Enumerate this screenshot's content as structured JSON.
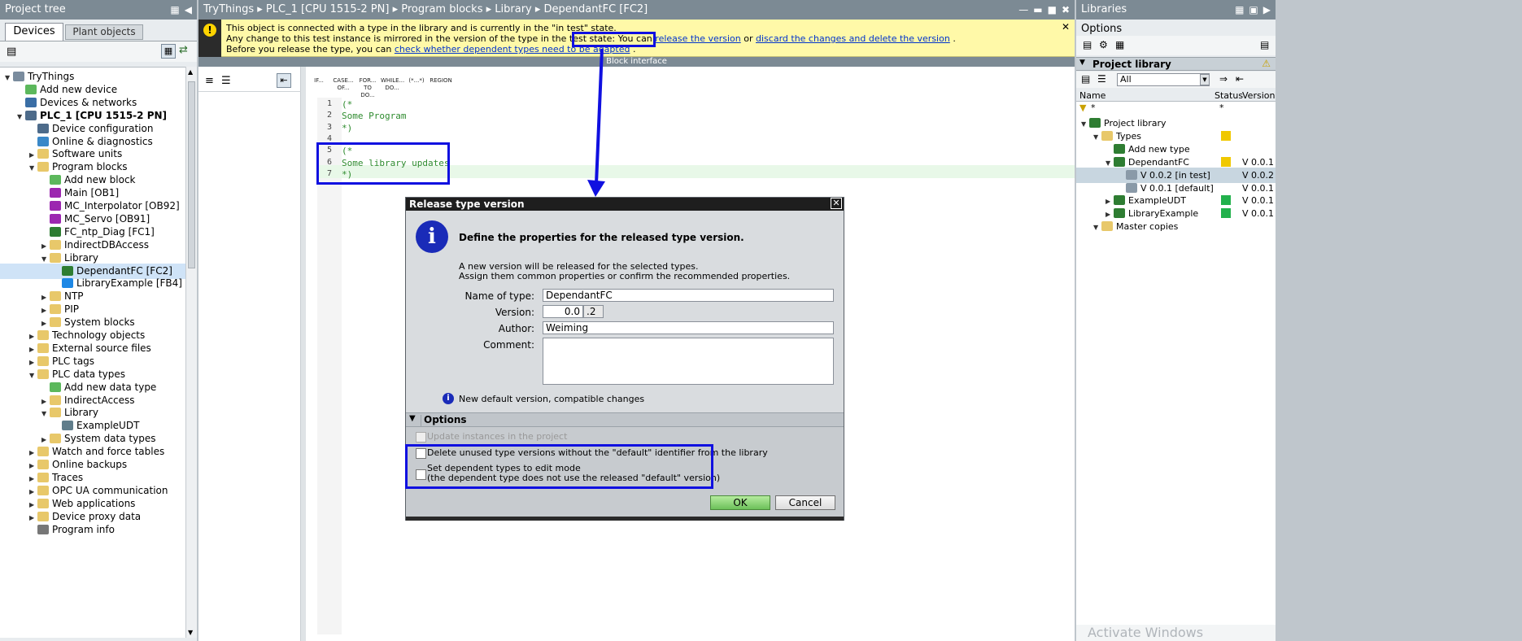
{
  "project_tree": {
    "title": "Project tree",
    "tabs": [
      "Devices",
      "Plant objects"
    ],
    "items": [
      {
        "label": "TryThings",
        "depth": 0,
        "arrow": "▼",
        "icon": "project-icon"
      },
      {
        "label": "Add new device",
        "depth": 1,
        "arrow": "",
        "icon": "add-icon"
      },
      {
        "label": "Devices & networks",
        "depth": 1,
        "arrow": "",
        "icon": "network-icon"
      },
      {
        "label": "PLC_1 [CPU 1515-2 PN]",
        "depth": 1,
        "arrow": "▼",
        "icon": "plc-icon",
        "bold": true
      },
      {
        "label": "Device configuration",
        "depth": 2,
        "arrow": "",
        "icon": "config-icon"
      },
      {
        "label": "Online & diagnostics",
        "depth": 2,
        "arrow": "",
        "icon": "diag-icon"
      },
      {
        "label": "Software units",
        "depth": 2,
        "arrow": "▶",
        "icon": "folder-icon"
      },
      {
        "label": "Program blocks",
        "depth": 2,
        "arrow": "▼",
        "icon": "folder-icon"
      },
      {
        "label": "Add new block",
        "depth": 3,
        "arrow": "",
        "icon": "add-icon"
      },
      {
        "label": "Main [OB1]",
        "depth": 3,
        "arrow": "",
        "icon": "ob-icon"
      },
      {
        "label": "MC_Interpolator [OB92]",
        "depth": 3,
        "arrow": "",
        "icon": "ob-icon"
      },
      {
        "label": "MC_Servo [OB91]",
        "depth": 3,
        "arrow": "",
        "icon": "ob-icon"
      },
      {
        "label": "FC_ntp_Diag [FC1]",
        "depth": 3,
        "arrow": "",
        "icon": "fc-icon"
      },
      {
        "label": "IndirectDBAccess",
        "depth": 3,
        "arrow": "▶",
        "icon": "folder-icon"
      },
      {
        "label": "Library",
        "depth": 3,
        "arrow": "▼",
        "icon": "folder-icon"
      },
      {
        "label": "DependantFC [FC2]",
        "depth": 4,
        "arrow": "",
        "icon": "fc-icon",
        "selected": true
      },
      {
        "label": "LibraryExample [FB4]",
        "depth": 4,
        "arrow": "",
        "icon": "fb-icon"
      },
      {
        "label": "NTP",
        "depth": 3,
        "arrow": "▶",
        "icon": "folder-icon"
      },
      {
        "label": "PIP",
        "depth": 3,
        "arrow": "▶",
        "icon": "folder-icon"
      },
      {
        "label": "System blocks",
        "depth": 3,
        "arrow": "▶",
        "icon": "folder-icon"
      },
      {
        "label": "Technology objects",
        "depth": 2,
        "arrow": "▶",
        "icon": "folder-icon"
      },
      {
        "label": "External source files",
        "depth": 2,
        "arrow": "▶",
        "icon": "folder-icon"
      },
      {
        "label": "PLC tags",
        "depth": 2,
        "arrow": "▶",
        "icon": "folder-icon"
      },
      {
        "label": "PLC data types",
        "depth": 2,
        "arrow": "▼",
        "icon": "folder-icon"
      },
      {
        "label": "Add new data type",
        "depth": 3,
        "arrow": "",
        "icon": "add-icon"
      },
      {
        "label": "IndirectAccess",
        "depth": 3,
        "arrow": "▶",
        "icon": "folder-icon"
      },
      {
        "label": "Library",
        "depth": 3,
        "arrow": "▼",
        "icon": "folder-icon"
      },
      {
        "label": "ExampleUDT",
        "depth": 4,
        "arrow": "",
        "icon": "udt-icon"
      },
      {
        "label": "System data types",
        "depth": 3,
        "arrow": "▶",
        "icon": "folder-icon"
      },
      {
        "label": "Watch and force tables",
        "depth": 2,
        "arrow": "▶",
        "icon": "folder-icon"
      },
      {
        "label": "Online backups",
        "depth": 2,
        "arrow": "▶",
        "icon": "folder-icon"
      },
      {
        "label": "Traces",
        "depth": 2,
        "arrow": "▶",
        "icon": "folder-icon"
      },
      {
        "label": "OPC UA communication",
        "depth": 2,
        "arrow": "▶",
        "icon": "folder-icon"
      },
      {
        "label": "Web applications",
        "depth": 2,
        "arrow": "▶",
        "icon": "folder-icon"
      },
      {
        "label": "Device proxy data",
        "depth": 2,
        "arrow": "▶",
        "icon": "folder-icon"
      },
      {
        "label": "Program info",
        "depth": 2,
        "arrow": "",
        "icon": "info-icon"
      }
    ]
  },
  "editor": {
    "breadcrumb": [
      "TryThings",
      "PLC_1 [CPU 1515-2 PN]",
      "Program blocks",
      "Library",
      "DependantFC [FC2]"
    ],
    "notice_line1": "This object is connected with a type in the library and is currently in the \"in test\" state.",
    "notice_line2_prefix": "Any change to this test instance is mirrored in the version of the type in the test state: You can",
    "notice_link_release": "release the version",
    "notice_or": "or",
    "notice_link_discard": "discard the changes and delete the version",
    "notice_line3_prefix": "Before you release the type, you can",
    "notice_link_check": "check whether dependent types need to be adapted",
    "block_interface": "Block interface",
    "toolbar_buttons": [
      "IF...",
      "CASE... OF...",
      "FOR... TO DO...",
      "WHILE... DO...",
      "(*...*)",
      "REGION"
    ],
    "code_lines": [
      {
        "n": "1",
        "text": "(*"
      },
      {
        "n": "2",
        "text": "Some Program"
      },
      {
        "n": "3",
        "text": "*)"
      },
      {
        "n": "4",
        "text": ""
      },
      {
        "n": "5",
        "text": "(*"
      },
      {
        "n": "6",
        "text": "Some library updates"
      },
      {
        "n": "7",
        "text": "*)"
      }
    ]
  },
  "dialog": {
    "title": "Release type version",
    "heading": "Define the properties for the released type version.",
    "desc1": "A new version will be released for the selected types.",
    "desc2": "Assign them common properties or confirm the recommended properties.",
    "name_label": "Name of type:",
    "name_value": "DependantFC",
    "version_label": "Version:",
    "version_major": "0.0",
    "version_minor": ".2",
    "author_label": "Author:",
    "author_value": "Weiming",
    "comment_label": "Comment:",
    "comment_value": "",
    "info_text": "New default version, compatible changes",
    "options_header": "Options",
    "opt_update": "Update instances in the project",
    "opt_delete": "Delete unused type versions without the \"default\" identifier from the library",
    "opt_setdep_1": "Set dependent types to edit mode",
    "opt_setdep_2": "(the dependent type does not use the released \"default\" version)",
    "ok": "OK",
    "cancel": "Cancel"
  },
  "libraries": {
    "title": "Libraries",
    "options": "Options",
    "project_library": "Project library",
    "filter_value": "All",
    "columns": [
      "Name",
      "Status",
      "Version"
    ],
    "filter_star": "*",
    "tree": [
      {
        "label": "Project library",
        "depth": 0,
        "arrow": "▼",
        "status": "",
        "version": ""
      },
      {
        "label": "Types",
        "depth": 1,
        "arrow": "▼",
        "status": "yellow",
        "version": ""
      },
      {
        "label": "Add new type",
        "depth": 2,
        "arrow": "",
        "status": "",
        "version": ""
      },
      {
        "label": "DependantFC",
        "depth": 2,
        "arrow": "▼",
        "status": "yellow",
        "version": "V 0.0.1"
      },
      {
        "label": "V 0.0.2 [in test]",
        "depth": 3,
        "arrow": "",
        "status": "",
        "version": "V 0.0.2",
        "selected": true
      },
      {
        "label": "V 0.0.1 [default]",
        "depth": 3,
        "arrow": "",
        "status": "",
        "version": "V 0.0.1"
      },
      {
        "label": "ExampleUDT",
        "depth": 2,
        "arrow": "▶",
        "status": "green",
        "version": "V 0.0.1"
      },
      {
        "label": "LibraryExample",
        "depth": 2,
        "arrow": "▶",
        "status": "green",
        "version": "V 0.0.1"
      },
      {
        "label": "Master copies",
        "depth": 1,
        "arrow": "▼",
        "status": "",
        "version": ""
      }
    ]
  },
  "watermark": "Activate Windows",
  "colors": {
    "panel_header": "#7c8a94",
    "notice": "#fff9a8",
    "highlight_box": "#1010e0",
    "ok_green": "#8fd47a"
  }
}
